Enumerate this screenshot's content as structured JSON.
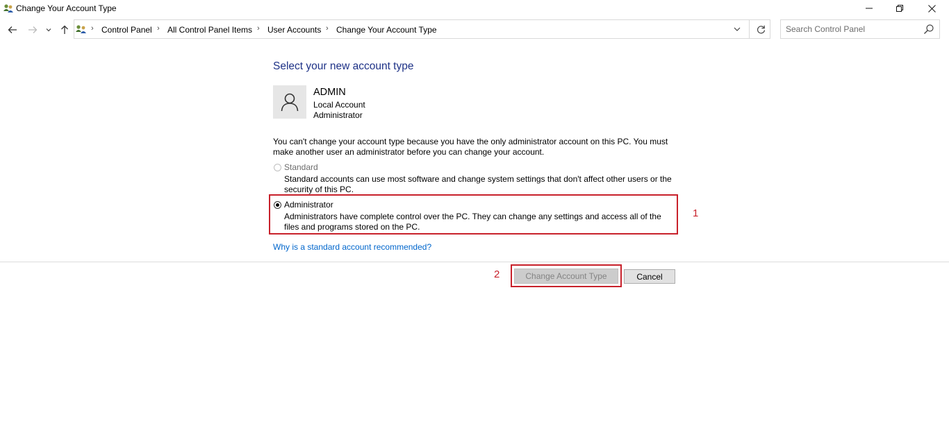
{
  "window": {
    "title": "Change Your Account Type",
    "app_icon": "users-icon",
    "controls": {
      "minimize": "minimize-icon",
      "maximize": "restore-icon",
      "close": "close-icon"
    }
  },
  "nav": {
    "back_icon": "arrow-left-icon",
    "forward_icon": "arrow-right-icon",
    "recent_icon": "chevron-down-icon",
    "up_icon": "arrow-up-icon"
  },
  "address": {
    "breadcrumbs": [
      "Control Panel",
      "All Control Panel Items",
      "User Accounts",
      "Change Your Account Type"
    ],
    "separator": "›",
    "dropdown_icon": "chevron-down-icon",
    "refresh_icon": "refresh-icon"
  },
  "search": {
    "placeholder": "Search Control Panel",
    "value": "",
    "icon": "search-icon"
  },
  "content": {
    "title": "Select your new account type",
    "account": {
      "name": "ADMIN",
      "type": "Local Account",
      "role": "Administrator",
      "avatar_icon": "user-icon"
    },
    "info": "You can't change your account type because you have the only administrator account on this PC. You must make another user an administrator before you can change your account.",
    "options": [
      {
        "label": "Standard",
        "description": "Standard accounts can use most software and change system settings that don't affect other users or the security of this PC.",
        "selected": false,
        "disabled": true
      },
      {
        "label": "Administrator",
        "description": "Administrators have complete control over the PC. They can change any settings and access all of the files and programs stored on the PC.",
        "selected": true,
        "disabled": false
      }
    ],
    "help_link": "Why is a standard account recommended?"
  },
  "actions": {
    "change_label": "Change Account Type",
    "cancel_label": "Cancel",
    "change_disabled": true
  },
  "annotations": {
    "marker_1": "1",
    "marker_2": "2",
    "color": "#c8212b"
  },
  "colors": {
    "title_blue": "#1e3287",
    "link_blue": "#0066cc",
    "highlight_red": "#c8212b"
  }
}
